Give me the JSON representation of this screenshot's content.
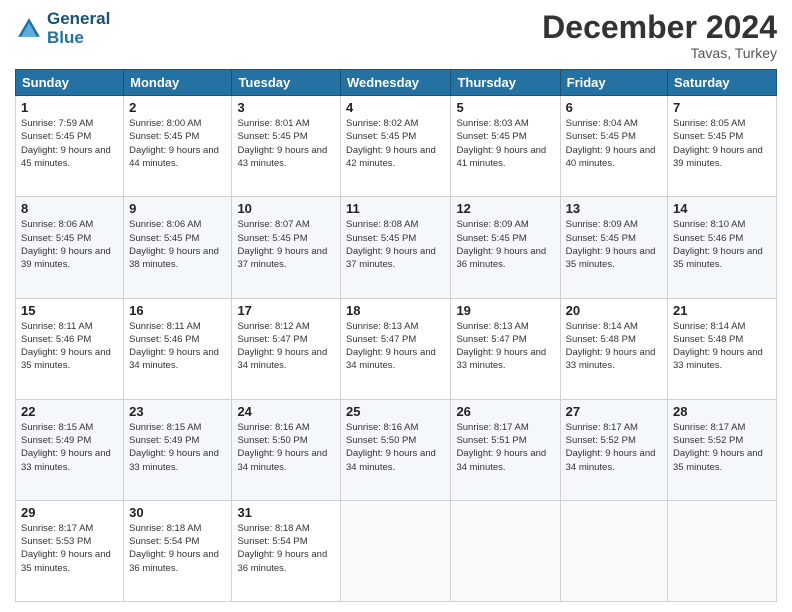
{
  "logo": {
    "line1": "General",
    "line2": "Blue"
  },
  "title": "December 2024",
  "subtitle": "Tavas, Turkey",
  "headers": [
    "Sunday",
    "Monday",
    "Tuesday",
    "Wednesday",
    "Thursday",
    "Friday",
    "Saturday"
  ],
  "weeks": [
    [
      {
        "day": "1",
        "sunrise": "7:59 AM",
        "sunset": "5:45 PM",
        "daylight": "9 hours and 45 minutes."
      },
      {
        "day": "2",
        "sunrise": "8:00 AM",
        "sunset": "5:45 PM",
        "daylight": "9 hours and 44 minutes."
      },
      {
        "day": "3",
        "sunrise": "8:01 AM",
        "sunset": "5:45 PM",
        "daylight": "9 hours and 43 minutes."
      },
      {
        "day": "4",
        "sunrise": "8:02 AM",
        "sunset": "5:45 PM",
        "daylight": "9 hours and 42 minutes."
      },
      {
        "day": "5",
        "sunrise": "8:03 AM",
        "sunset": "5:45 PM",
        "daylight": "9 hours and 41 minutes."
      },
      {
        "day": "6",
        "sunrise": "8:04 AM",
        "sunset": "5:45 PM",
        "daylight": "9 hours and 40 minutes."
      },
      {
        "day": "7",
        "sunrise": "8:05 AM",
        "sunset": "5:45 PM",
        "daylight": "9 hours and 39 minutes."
      }
    ],
    [
      {
        "day": "8",
        "sunrise": "8:06 AM",
        "sunset": "5:45 PM",
        "daylight": "9 hours and 39 minutes."
      },
      {
        "day": "9",
        "sunrise": "8:06 AM",
        "sunset": "5:45 PM",
        "daylight": "9 hours and 38 minutes."
      },
      {
        "day": "10",
        "sunrise": "8:07 AM",
        "sunset": "5:45 PM",
        "daylight": "9 hours and 37 minutes."
      },
      {
        "day": "11",
        "sunrise": "8:08 AM",
        "sunset": "5:45 PM",
        "daylight": "9 hours and 37 minutes."
      },
      {
        "day": "12",
        "sunrise": "8:09 AM",
        "sunset": "5:45 PM",
        "daylight": "9 hours and 36 minutes."
      },
      {
        "day": "13",
        "sunrise": "8:09 AM",
        "sunset": "5:45 PM",
        "daylight": "9 hours and 35 minutes."
      },
      {
        "day": "14",
        "sunrise": "8:10 AM",
        "sunset": "5:46 PM",
        "daylight": "9 hours and 35 minutes."
      }
    ],
    [
      {
        "day": "15",
        "sunrise": "8:11 AM",
        "sunset": "5:46 PM",
        "daylight": "9 hours and 35 minutes."
      },
      {
        "day": "16",
        "sunrise": "8:11 AM",
        "sunset": "5:46 PM",
        "daylight": "9 hours and 34 minutes."
      },
      {
        "day": "17",
        "sunrise": "8:12 AM",
        "sunset": "5:47 PM",
        "daylight": "9 hours and 34 minutes."
      },
      {
        "day": "18",
        "sunrise": "8:13 AM",
        "sunset": "5:47 PM",
        "daylight": "9 hours and 34 minutes."
      },
      {
        "day": "19",
        "sunrise": "8:13 AM",
        "sunset": "5:47 PM",
        "daylight": "9 hours and 33 minutes."
      },
      {
        "day": "20",
        "sunrise": "8:14 AM",
        "sunset": "5:48 PM",
        "daylight": "9 hours and 33 minutes."
      },
      {
        "day": "21",
        "sunrise": "8:14 AM",
        "sunset": "5:48 PM",
        "daylight": "9 hours and 33 minutes."
      }
    ],
    [
      {
        "day": "22",
        "sunrise": "8:15 AM",
        "sunset": "5:49 PM",
        "daylight": "9 hours and 33 minutes."
      },
      {
        "day": "23",
        "sunrise": "8:15 AM",
        "sunset": "5:49 PM",
        "daylight": "9 hours and 33 minutes."
      },
      {
        "day": "24",
        "sunrise": "8:16 AM",
        "sunset": "5:50 PM",
        "daylight": "9 hours and 34 minutes."
      },
      {
        "day": "25",
        "sunrise": "8:16 AM",
        "sunset": "5:50 PM",
        "daylight": "9 hours and 34 minutes."
      },
      {
        "day": "26",
        "sunrise": "8:17 AM",
        "sunset": "5:51 PM",
        "daylight": "9 hours and 34 minutes."
      },
      {
        "day": "27",
        "sunrise": "8:17 AM",
        "sunset": "5:52 PM",
        "daylight": "9 hours and 34 minutes."
      },
      {
        "day": "28",
        "sunrise": "8:17 AM",
        "sunset": "5:52 PM",
        "daylight": "9 hours and 35 minutes."
      }
    ],
    [
      {
        "day": "29",
        "sunrise": "8:17 AM",
        "sunset": "5:53 PM",
        "daylight": "9 hours and 35 minutes."
      },
      {
        "day": "30",
        "sunrise": "8:18 AM",
        "sunset": "5:54 PM",
        "daylight": "9 hours and 36 minutes."
      },
      {
        "day": "31",
        "sunrise": "8:18 AM",
        "sunset": "5:54 PM",
        "daylight": "9 hours and 36 minutes."
      },
      null,
      null,
      null,
      null
    ]
  ]
}
